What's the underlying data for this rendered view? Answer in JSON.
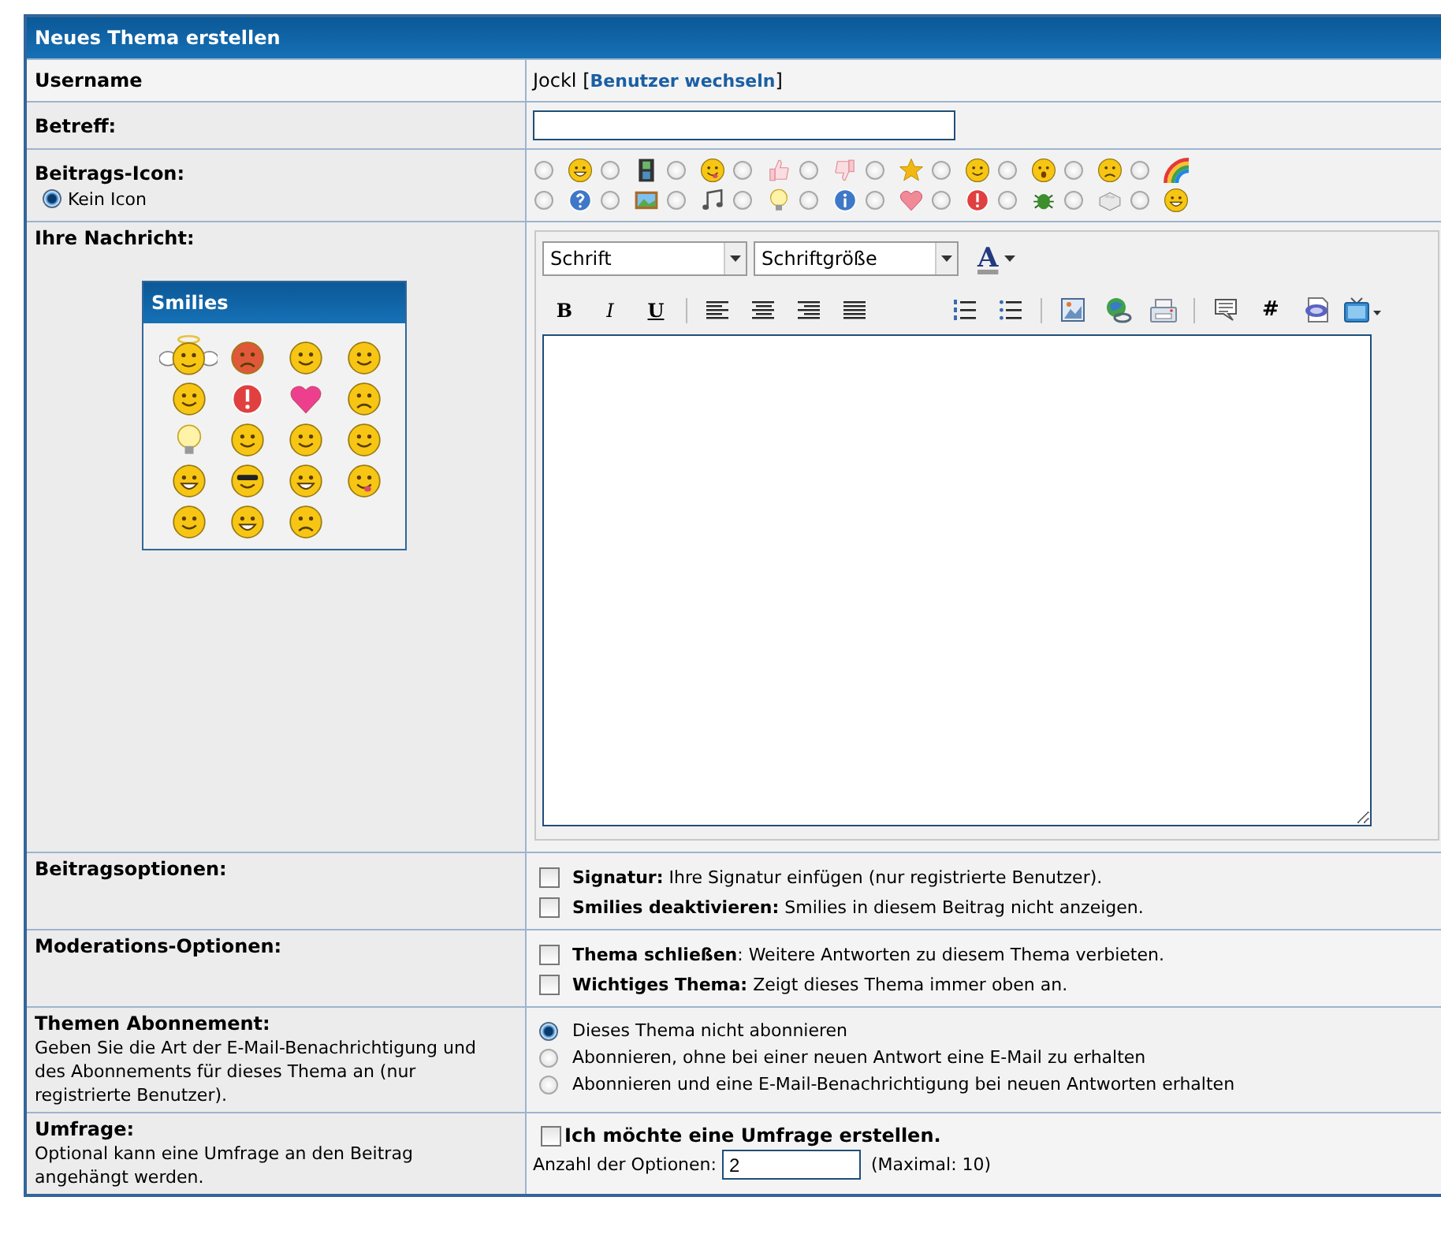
{
  "form": {
    "title": "Neues Thema erstellen"
  },
  "username": {
    "label": "Username",
    "value": "Jockl",
    "link_open": "[",
    "link": "Benutzer wechseln",
    "link_close": "]"
  },
  "subject": {
    "label": "Betreff:"
  },
  "post_icon": {
    "label": "Beitrags-Icon:",
    "none_option": {
      "label": "Kein Icon",
      "selected": true
    },
    "icons": [
      {
        "selected": false
      },
      {
        "selected": false
      },
      {
        "selected": false
      },
      {
        "selected": false
      },
      {
        "selected": false
      },
      {
        "selected": false
      },
      {
        "selected": false
      },
      {
        "selected": false
      },
      {
        "selected": false
      },
      {
        "selected": false
      },
      {
        "selected": false
      },
      {
        "selected": false
      },
      {
        "selected": false
      },
      {
        "selected": false
      },
      {
        "selected": false
      },
      {
        "selected": false
      },
      {
        "selected": false
      },
      {
        "selected": false
      },
      {
        "selected": false
      },
      {
        "selected": false
      }
    ]
  },
  "message": {
    "label": "Ihre Nachricht:",
    "smilies": {
      "title": "Smilies"
    },
    "editor": {
      "font": "Schrift",
      "size": "Schriftgröße",
      "color_button": "A",
      "format_buttons": [
        "B",
        "I",
        "U"
      ],
      "hash_button": "#"
    }
  },
  "post_options": {
    "label": "Beitragsoptionen:",
    "options": [
      {
        "text": "**Signatur:** Ihre Signatur einfügen (nur registrierte Benutzer).",
        "checked": false
      },
      {
        "text": "**Smilies deaktivieren:** Smilies in diesem Beitrag nicht anzeigen.",
        "checked": false
      }
    ]
  },
  "moderation": {
    "label": "Moderations-Optionen:",
    "options": [
      {
        "text": "**Thema schließen**: Weitere Antworten zu diesem Thema verbieten.",
        "checked": false
      },
      {
        "text": "**Wichtiges Thema:** Zeigt dieses Thema immer oben an.",
        "checked": false
      }
    ]
  },
  "subscription": {
    "label": "Themen Abonnement:",
    "description": "Geben Sie die Art der E-Mail-Benachrichtigung und des Abonnements für dieses Thema an (nur registrierte Benutzer).",
    "options": [
      {
        "label": "Dieses Thema nicht abonnieren",
        "selected": true
      },
      {
        "label": "Abonnieren, ohne bei einer neuen Antwort eine E-Mail zu erhalten",
        "selected": false
      },
      {
        "label": "Abonnieren und eine E-Mail-Benachrichtigung bei neuen Antworten erhalten",
        "selected": false
      }
    ]
  },
  "poll": {
    "label": "Umfrage:",
    "description": "Optional kann eine Umfrage an den Beitrag angehängt werden.",
    "checkbox": {
      "label": "Ich möchte eine Umfrage erstellen.",
      "checked": false
    },
    "count_label": "Anzahl der Optionen:",
    "count_value": "2",
    "max_note": "(Maximal: 10)"
  }
}
